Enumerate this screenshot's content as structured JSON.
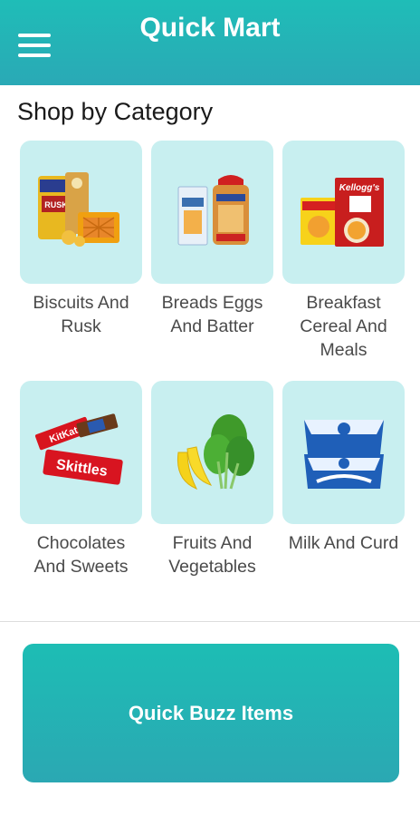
{
  "app_bar": {
    "title": "Quick Mart",
    "menu_icon": "hamburger-menu-icon",
    "color": "#24b4b6"
  },
  "section": {
    "title": "Shop by Category"
  },
  "categories": [
    {
      "label": "Biscuits And\nRusk",
      "icon": "biscuits-rusk-image"
    },
    {
      "label": "Breads Eggs\nAnd Batter",
      "icon": "bread-eggs-image"
    },
    {
      "label": "Breakfast\nCereal And\nMeals",
      "icon": "cereal-noodles-image"
    },
    {
      "label": "Chocolates\nAnd Sweets",
      "icon": "chocolates-image"
    },
    {
      "label": "Fruits And\nVegetables",
      "icon": "banana-spinach-image"
    },
    {
      "label": "Milk And Curd",
      "icon": "milk-packets-image"
    }
  ],
  "quick_buzz": {
    "label": "Quick Buzz Items"
  },
  "colors": {
    "tile_bg": "#c8eff0",
    "accent": "#1dbdb4"
  }
}
